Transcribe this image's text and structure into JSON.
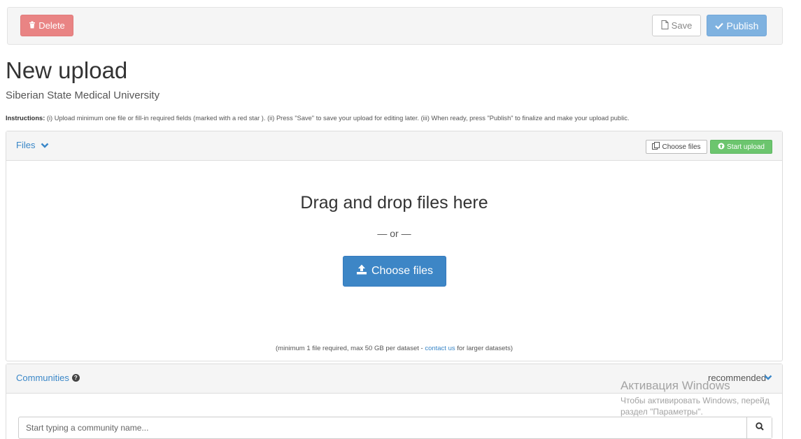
{
  "toolbar": {
    "delete_label": "Delete",
    "save_label": "Save",
    "publish_label": "Publish"
  },
  "page": {
    "title": "New upload",
    "subtitle": "Siberian State Medical University",
    "instructions_label": "Instructions:",
    "instructions_text": " (i) Upload minimum one file or fill-in required fields (marked with a red star ). (ii) Press \"Save\" to save your upload for editing later. (iii) When ready, press \"Publish\" to finalize and make your upload public."
  },
  "files_panel": {
    "title": "Files",
    "choose_files_small": "Choose files",
    "start_upload": "Start upload",
    "drop_title": "Drag and drop files here",
    "or_text": "— or —",
    "choose_files_big": "Choose files",
    "note_prefix": "(minimum 1 file required, max 50 GB per dataset - ",
    "note_link": "contact us",
    "note_suffix": " for larger datasets)"
  },
  "communities_panel": {
    "title": "Communities",
    "recommended": "recommended",
    "search_placeholder": "Start typing a community name..."
  },
  "watermark": {
    "title": "Активация Windows",
    "line1": "Чтобы активировать Windows, перейд",
    "line2": "раздел \"Параметры\"."
  },
  "colors": {
    "delete": "#e98484",
    "publish": "#7fb2e0",
    "start_upload": "#6cc56e",
    "primary": "#3d86c6",
    "link": "#3a87c8"
  },
  "icons": {
    "delete": "trash-icon",
    "save": "file-icon",
    "publish": "check-icon",
    "files_toggle": "chevron-down-icon",
    "choose_small": "copy-files-icon",
    "start_upload": "circle-arrow-up-icon",
    "choose_big": "upload-icon",
    "help": "question-circle-icon",
    "search": "search-icon"
  }
}
